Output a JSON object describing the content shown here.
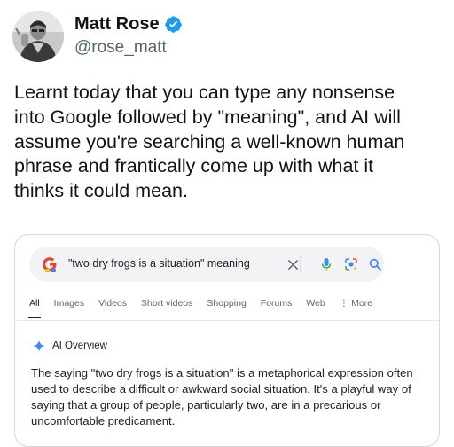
{
  "author": {
    "display_name": "Matt Rose",
    "handle": "@rose_matt"
  },
  "tweet": {
    "text": "Learnt today that you can type any nonsense\ninto Google followed by \"meaning\", and AI will\nassume you're searching a well-known human\nphrase and frantically come up with what it\nthinks it could mean."
  },
  "search": {
    "query": "\"two dry frogs is a situation\" meaning",
    "tabs": [
      "All",
      "Images",
      "Videos",
      "Short videos",
      "Shopping",
      "Forums",
      "Web",
      "More"
    ],
    "active_tab": "All"
  },
  "ai_overview": {
    "label": "AI Overview",
    "text": "The saying \"two dry frogs is a situation\" is a metaphorical expression often used to describe a difficult or awkward social situation. It's a playful way of saying that a group of people, particularly two, are in a precarious or uncomfortable predicament."
  },
  "colors": {
    "verified_blue": "#1d9bf0",
    "handle_gray": "#536471",
    "card_border": "#cfd9de",
    "search_bg": "#f1f3f4",
    "google_blue": "#4285f4"
  },
  "icons": [
    "avatar",
    "verified-badge-icon",
    "google-logo-icon",
    "clear-icon",
    "mic-icon",
    "lens-icon",
    "search-icon",
    "more-dots-icon",
    "ai-sparkle-icon"
  ]
}
